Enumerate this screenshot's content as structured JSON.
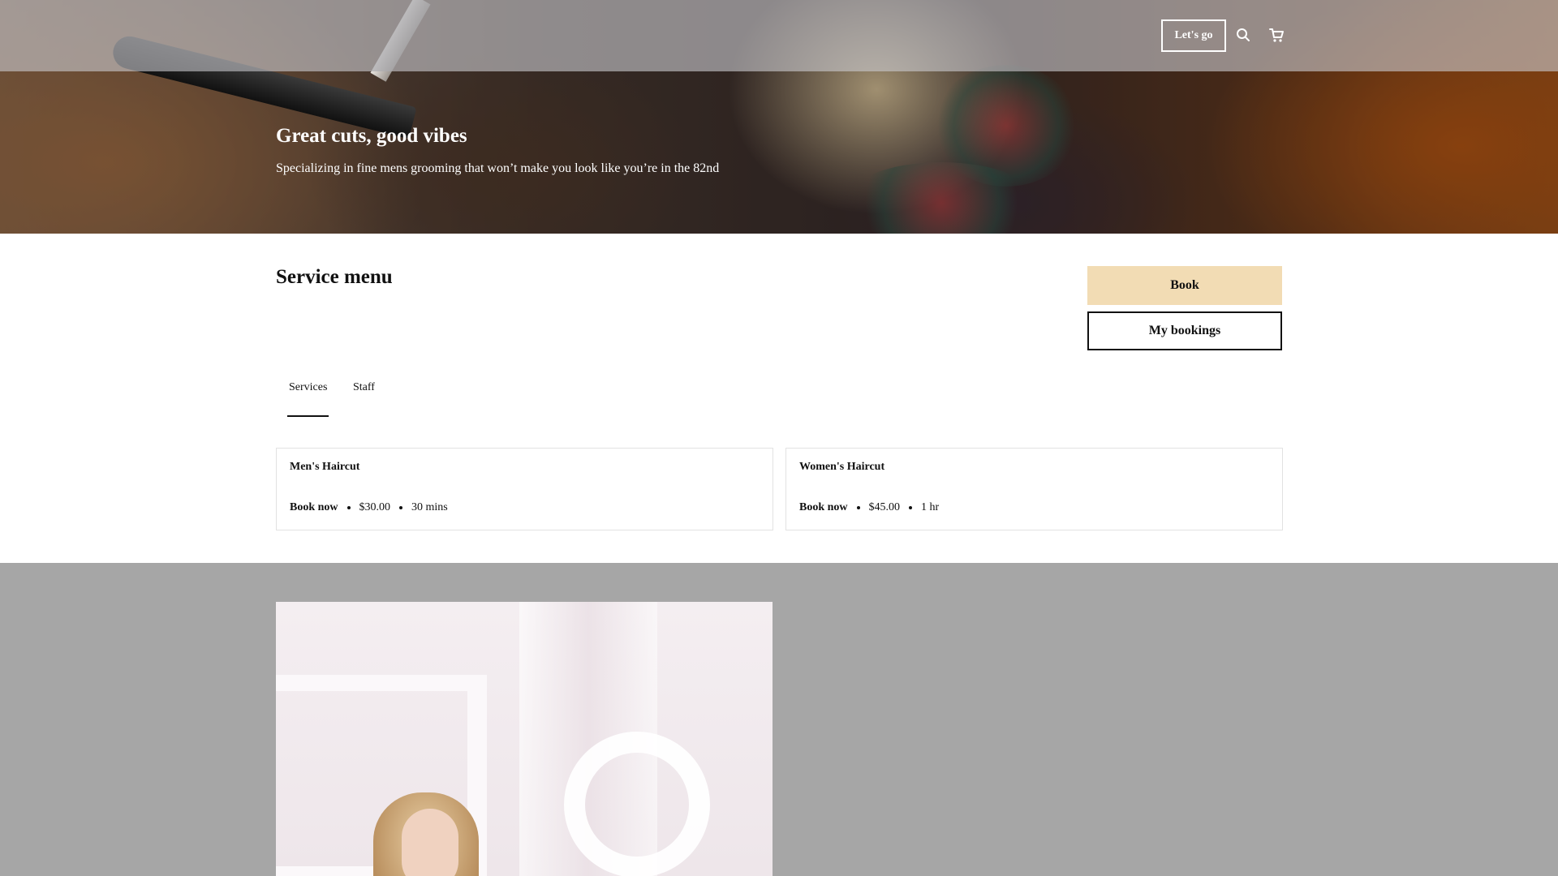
{
  "header": {
    "cta_label": "Let's go",
    "search_icon": "search-icon",
    "cart_icon": "cart-icon"
  },
  "hero": {
    "title": "Great cuts, good vibes",
    "subtitle": "Specializing in fine mens grooming that won’t make you look like you’re in the 82nd"
  },
  "service_menu": {
    "title": "Service menu",
    "book_label": "Book",
    "my_bookings_label": "My bookings",
    "tabs": [
      {
        "label": "Services",
        "active": true
      },
      {
        "label": "Staff",
        "active": false
      }
    ],
    "services": [
      {
        "name": "Men's Haircut",
        "action": "Book now",
        "price": "$30.00",
        "duration": "30 mins"
      },
      {
        "name": "Women's Haircut",
        "action": "Book now",
        "price": "$45.00",
        "duration": "1 hr"
      }
    ]
  },
  "colors": {
    "book_button": "#f2dcb4",
    "topbar": "#aaaaaf",
    "gallery_background": "#a6a6a6",
    "text": "#111111"
  }
}
